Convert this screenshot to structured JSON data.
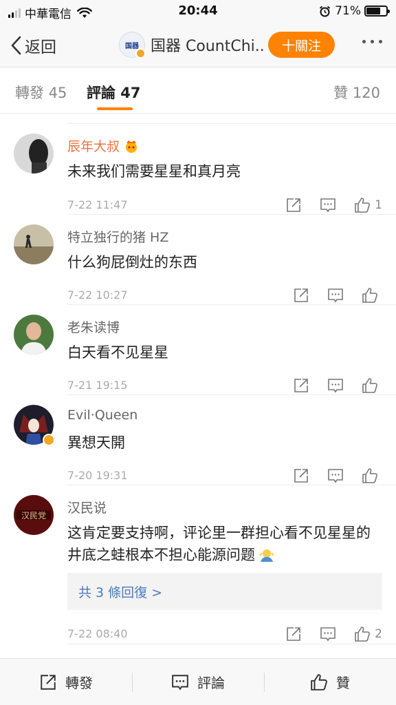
{
  "status_bar": {
    "carrier": "中華電信",
    "time": "20:44",
    "battery": "71%",
    "battery_level": 0.71
  },
  "nav": {
    "back_label": "返回",
    "account_name": "国器 CountChi...",
    "account_logo": "国器",
    "follow_label": "十關注"
  },
  "tabs": {
    "repost": "轉發 45",
    "comment": "評論 47",
    "like": "贊 120"
  },
  "comments": [
    {
      "user": "辰年大叔",
      "text": "未来我们需要星星和真月亮",
      "time": "7-22 11:47",
      "likes": "1"
    },
    {
      "user": "特立独行的猪 HZ",
      "text": "什么狗屁倒灶的东西",
      "time": "7-22 10:27",
      "likes": ""
    },
    {
      "user": "老朱读博",
      "text": "白天看不见星星",
      "time": "7-21 19:15",
      "likes": ""
    },
    {
      "user": "Evil·Queen",
      "text": "異想天開",
      "time": "7-20 19:31",
      "likes": ""
    },
    {
      "user": "汉民说",
      "text": "这肯定要支持啊，评论里一群担心看不见星星的井底之蛙根本不担心能源问题",
      "time": "7-22 08:40",
      "likes": "2",
      "replies": "共 3 條回復 >",
      "avatar_text": "汉民党"
    }
  ],
  "bottom_bar": {
    "repost": "轉發",
    "comment": "評論",
    "like": "贊"
  },
  "colors": {
    "accent": "#ff8200",
    "vip_name": "#eb7340",
    "link": "#4a7bbd"
  }
}
